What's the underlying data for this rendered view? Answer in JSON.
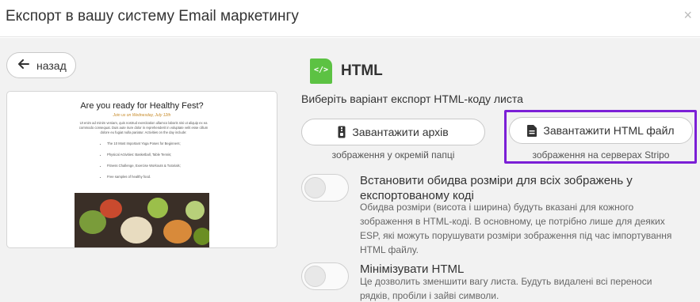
{
  "dialog": {
    "title": "Експорт в вашу систему Email маркетингу",
    "close_symbol": "×"
  },
  "back_button": {
    "label": "назад",
    "arrow": "🡐"
  },
  "preview": {
    "heading": "Are you ready for Healthy Fest?",
    "subheading": "Join us on Wednesday, July 12th",
    "paragraph": "Ut enim ad minim veniam, quis nostrud exercitation ullamco laboris nisi ut aliquip ex ea commodo consequat. Duis aute irure dolor in reprehenderit in voluptate velit esse cillum dolore eu fugiat nulla pariatur. Activities on the day include:",
    "list": [
      "The 10 Most Important Yoga Poses for Beginners;",
      "Physical Activities: Basketball, Table Tennis;",
      "Fitness Challenge, Exercise Workouts & Tutorials;",
      "Free samples of healthy food."
    ]
  },
  "format": {
    "badge_code": "</>",
    "label": "HTML",
    "badge_color": "#5cc243"
  },
  "subtitle": "Виберіть варіант експорт HTML-коду листа",
  "options": {
    "archive": {
      "label": "Завантажити архів",
      "icon": "zip-archive-icon",
      "caption": "зображення у окремій папці"
    },
    "html_file": {
      "label": "Завантажити HTML файл",
      "icon": "document-icon",
      "caption": "зображення на серверах Stripo",
      "highlight_color": "#7b1fd6"
    }
  },
  "settings": [
    {
      "title": "Встановити обидва розміри для всіх зображень у експортованому коді",
      "description": "Обидва розміри (висота і ширина) будуть вказані для кожного зображення в HTML-коді. В основному, це потрібно лише для деяких ESP, які можуть порушувати розміри зображення під час імпортування HTML файлу.",
      "enabled": false
    },
    {
      "title": "Мінімізувати HTML",
      "description": "Це дозволить зменшити вагу листа. Будуть видалені всі переноси рядків, пробіли і зайві символи.",
      "enabled": false
    }
  ]
}
